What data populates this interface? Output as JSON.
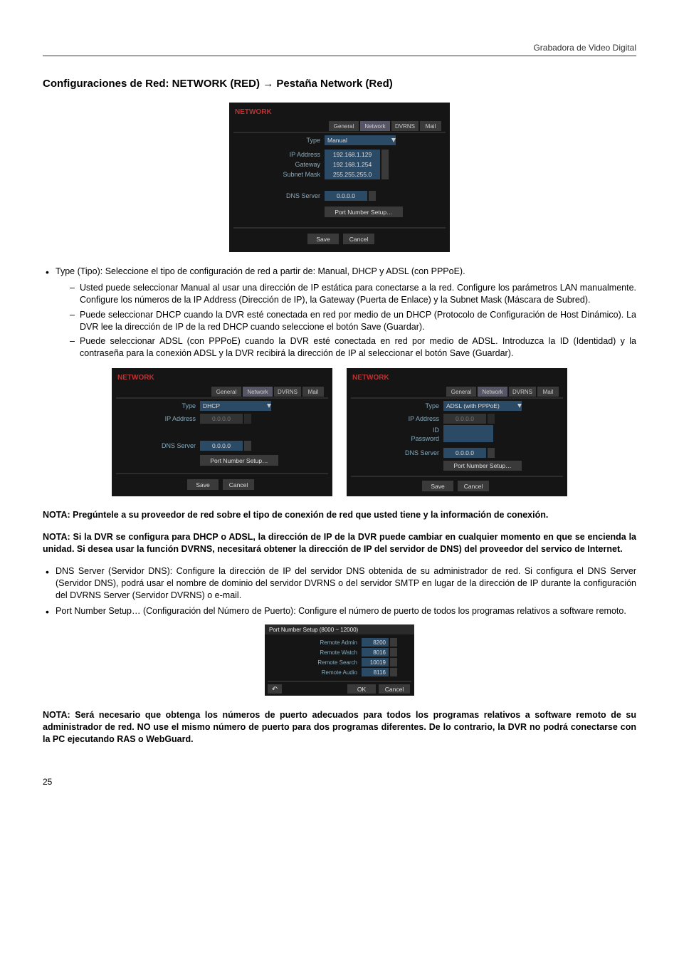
{
  "header": {
    "product": "Grabadora de Video Digital"
  },
  "section_title_prefix": "Configuraciones de Red: NETWORK (RED)",
  "section_title_arrow": "→",
  "section_title_suffix": "Pestaña Network (Red)",
  "fig_main": {
    "title": "NETWORK",
    "tabs": [
      "General",
      "Network",
      "DVRNS",
      "Mail"
    ],
    "active_tab": 1,
    "fields": {
      "type_label": "Type",
      "type_value": "Manual",
      "ip_label": "IP Address",
      "ip_value": "192.168.1.129",
      "gw_label": "Gateway",
      "gw_value": "192.168.1.254",
      "mask_label": "Subnet Mask",
      "mask_value": "255.255.255.0",
      "dns_label": "DNS Server",
      "dns_value": "0.0.0.0",
      "port_btn": "Port Number Setup…",
      "save_btn": "Save",
      "cancel_btn": "Cancel"
    }
  },
  "bullet_type_lead": "Type (Tipo)",
  "bullet_type_rest": ": Seleccione el tipo de configuración de red a partir de: Manual, DHCP y ADSL (con PPPoE).",
  "dashes": [
    {
      "lead": "Usted puede seleccionar ",
      "term": "Manual",
      "rest": " al usar una dirección de IP estática para conectarse a la red. Configure los parámetros LAN manualmente. Configure los números de la IP Address (Dirección de IP), la Gateway (Puerta de Enlace) y la Subnet Mask (Máscara de Subred)."
    },
    {
      "lead": "Puede seleccionar ",
      "term": "DHCP",
      "rest": " cuando la DVR esté conectada en red por medio de un DHCP (Protocolo de Configuración de Host Dinámico). La DVR lee la dirección de IP de la red DHCP cuando seleccione el botón ",
      "term2": "Save (Guardar)",
      "tail": "."
    },
    {
      "lead": "Puede seleccionar ",
      "term": "ADSL (con PPPoE)",
      "rest": " cuando la DVR esté conectada en red por medio de ADSL. Introduzca la ID (Identidad) y la contraseña para la conexión ADSL y la DVR recibirá la dirección de IP al seleccionar el botón ",
      "term2": "Save (Guardar)",
      "tail": "."
    }
  ],
  "fig_dhcp": {
    "title": "NETWORK",
    "tabs": [
      "General",
      "Network",
      "DVRNS",
      "Mail"
    ],
    "fields": {
      "type_label": "Type",
      "type_value": "DHCP",
      "ip_label": "IP Address",
      "ip_value": "0.0.0.0",
      "dns_label": "DNS Server",
      "dns_value": "0.0.0.0",
      "port_btn": "Port Number Setup…",
      "save_btn": "Save",
      "cancel_btn": "Cancel"
    }
  },
  "fig_adsl": {
    "title": "NETWORK",
    "tabs": [
      "General",
      "Network",
      "DVRNS",
      "Mail"
    ],
    "fields": {
      "type_label": "Type",
      "type_value": "ADSL (with PPPoE)",
      "ip_label": "IP Address",
      "ip_value": "0.0.0.0",
      "id_label": "ID",
      "pw_label": "Password",
      "dns_label": "DNS Server",
      "dns_value": "0.0.0.0",
      "port_btn": "Port Number Setup…",
      "save_btn": "Save",
      "cancel_btn": "Cancel"
    }
  },
  "nota1": "NOTA: Pregúntele a su proveedor de red sobre el tipo de conexión de red que usted tiene y la información de conexión.",
  "nota2": "NOTA: Si la DVR se configura para DHCP o ADSL, la dirección de IP de la DVR puede cambiar en cualquier momento en que se encienda la unidad. Si desea usar la función DVRNS, necesitará obtener la dirección de IP del servidor de DNS) del proveedor del servico de Internet.",
  "bullets2": [
    {
      "lead": "DNS Server (Servidor DNS)",
      "rest": ": Configure la dirección de IP del servidor DNS obtenida de su administrador de red. Si configura el DNS Server (Servidor DNS), podrá usar el nombre de dominio del servidor DVRNS o del servidor SMTP en lugar de la dirección de IP durante la configuración del DVRNS Server (Servidor DVRNS) o e-mail."
    },
    {
      "lead": "Port Number Setup… (Configuración del Número de Puerto)",
      "rest": ": Configure el número de puerto de todos los programas relativos a software remoto."
    }
  ],
  "fig_port": {
    "title": "Port Number Setup (8000 ~ 12000)",
    "rows": [
      {
        "label": "Remote Admin",
        "value": "8200"
      },
      {
        "label": "Remote Watch",
        "value": "8016"
      },
      {
        "label": "Remote Search",
        "value": "10019"
      },
      {
        "label": "Remote Audio",
        "value": "8116"
      }
    ],
    "ok_btn": "OK",
    "cancel_btn": "Cancel",
    "back_icon": "↶"
  },
  "nota3": "NOTA: Será necesario que obtenga los números de puerto adecuados para todos los programas relativos a software remoto de su administrador de red. NO use el mismo número de puerto para dos programas diferentes. De lo contrario, la DVR no podrá conectarse con la PC ejecutando RAS o WebGuard.",
  "page_number": "25"
}
